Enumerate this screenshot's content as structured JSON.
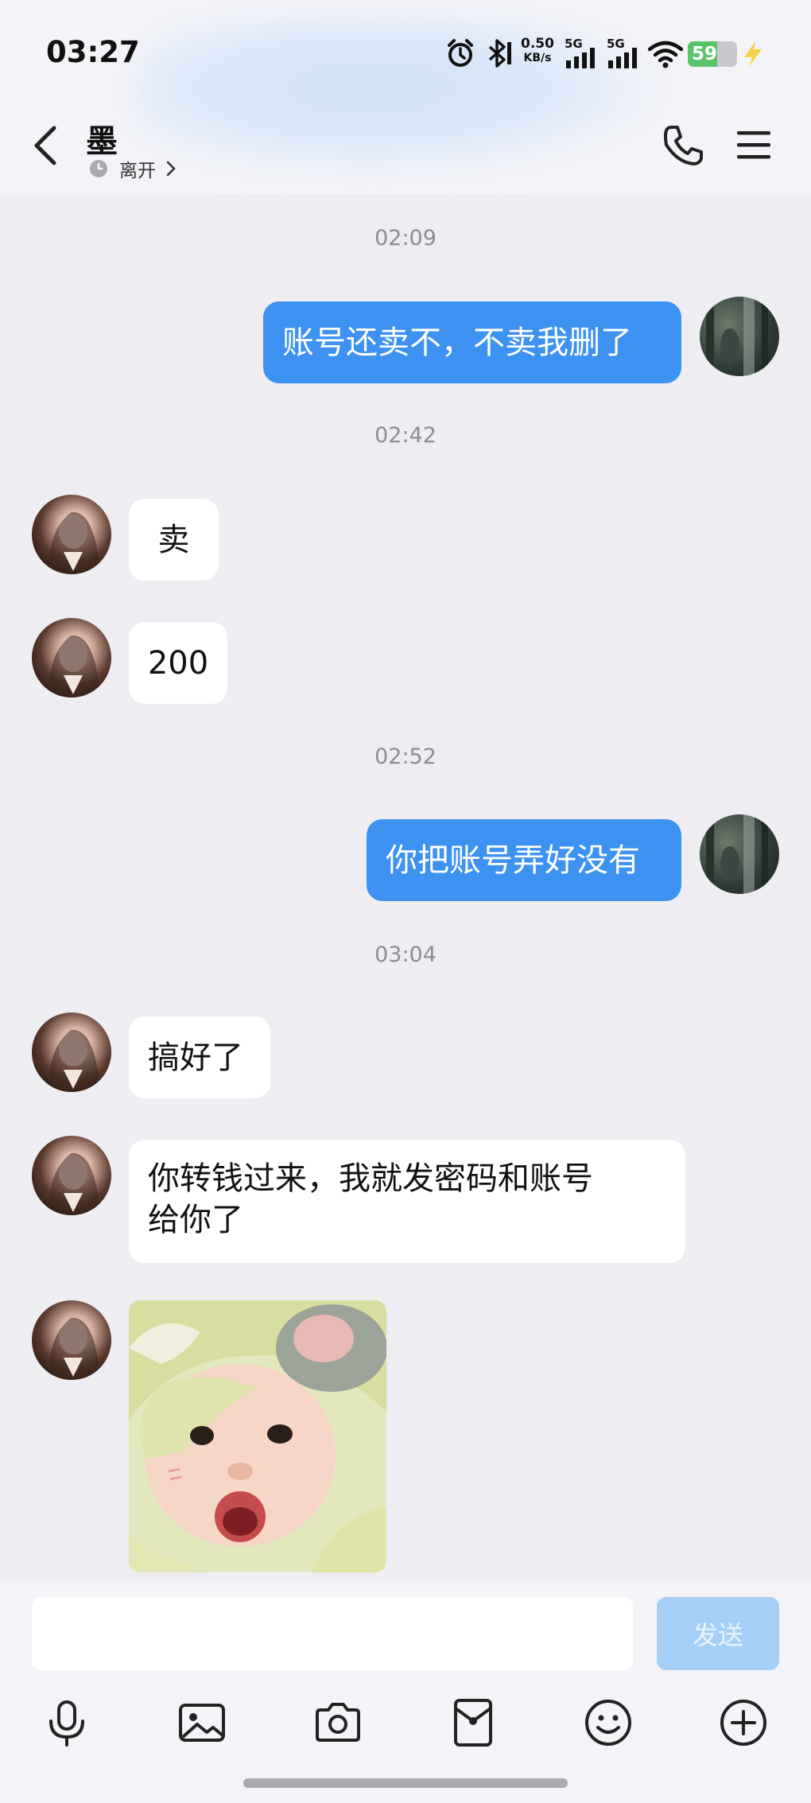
{
  "status_bar": {
    "time": "03:27",
    "net_speed_value": "0.50",
    "net_speed_unit": "KB/s",
    "signal1_label": "5G",
    "signal2_label": "5G",
    "battery_level": "59",
    "battery_fraction": 0.59
  },
  "header": {
    "contact_name": "墨",
    "presence": "离开"
  },
  "messages": [
    {
      "kind": "time",
      "text": "02:09"
    },
    {
      "kind": "self",
      "text": "账号还卖不，不卖我删了"
    },
    {
      "kind": "time",
      "text": "02:42"
    },
    {
      "kind": "other",
      "text": "卖"
    },
    {
      "kind": "other",
      "text": "200"
    },
    {
      "kind": "time",
      "text": "02:52"
    },
    {
      "kind": "self",
      "text": "你把账号弄好没有"
    },
    {
      "kind": "time",
      "text": "03:04"
    },
    {
      "kind": "other",
      "text": "搞好了"
    },
    {
      "kind": "other",
      "line1": "你转钱过来，我就发密码和账号",
      "line2": "给你了"
    },
    {
      "kind": "other-sticker"
    }
  ],
  "composer": {
    "input_value": "",
    "send_label": "发送"
  },
  "toolbar_icons": [
    "microphone-icon",
    "image-icon",
    "camera-icon",
    "red-packet-icon",
    "emoji-icon",
    "plus-icon"
  ],
  "colors": {
    "accent": "#3E92F2",
    "send_disabled": "#A6CFF7",
    "background": "#EDEDF2"
  }
}
